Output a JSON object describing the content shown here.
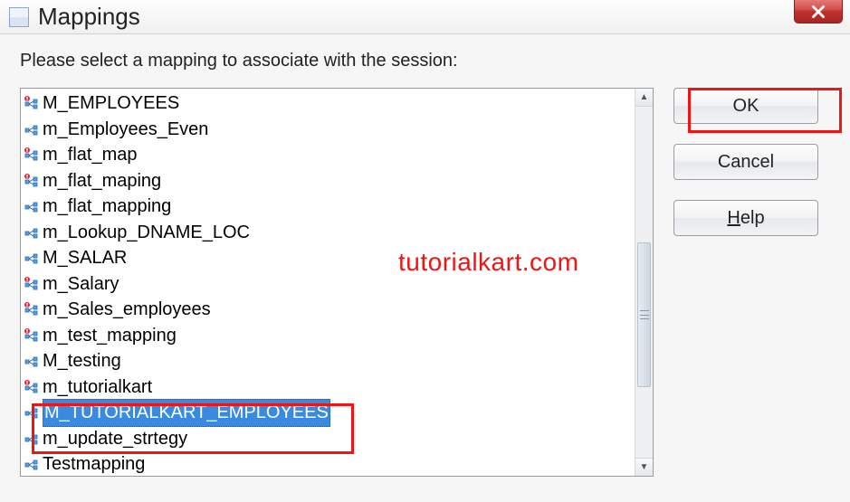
{
  "window": {
    "title": "Mappings"
  },
  "prompt": "Please select a mapping to associate with the session:",
  "mappings": [
    {
      "name": "M_EMPLOYEES",
      "valid": false
    },
    {
      "name": "m_Employees_Even",
      "valid": true
    },
    {
      "name": "m_flat_map",
      "valid": false
    },
    {
      "name": "m_flat_maping",
      "valid": false
    },
    {
      "name": "m_flat_mapping",
      "valid": true
    },
    {
      "name": "m_Lookup_DNAME_LOC",
      "valid": true
    },
    {
      "name": "M_SALAR",
      "valid": true
    },
    {
      "name": "m_Salary",
      "valid": false
    },
    {
      "name": "m_Sales_employees",
      "valid": false
    },
    {
      "name": "m_test_mapping",
      "valid": false
    },
    {
      "name": "M_testing",
      "valid": true
    },
    {
      "name": "m_tutorialkart",
      "valid": false
    },
    {
      "name": "M_TUTORIALKART_EMPLOYEES",
      "valid": true,
      "selected": true
    },
    {
      "name": "m_update_strtegy",
      "valid": true
    },
    {
      "name": "Testmapping",
      "valid": true
    }
  ],
  "buttons": {
    "ok": "OK",
    "cancel": "Cancel",
    "help_prefix": "H",
    "help_rest": "elp"
  },
  "watermark": "tutorialkart.com"
}
